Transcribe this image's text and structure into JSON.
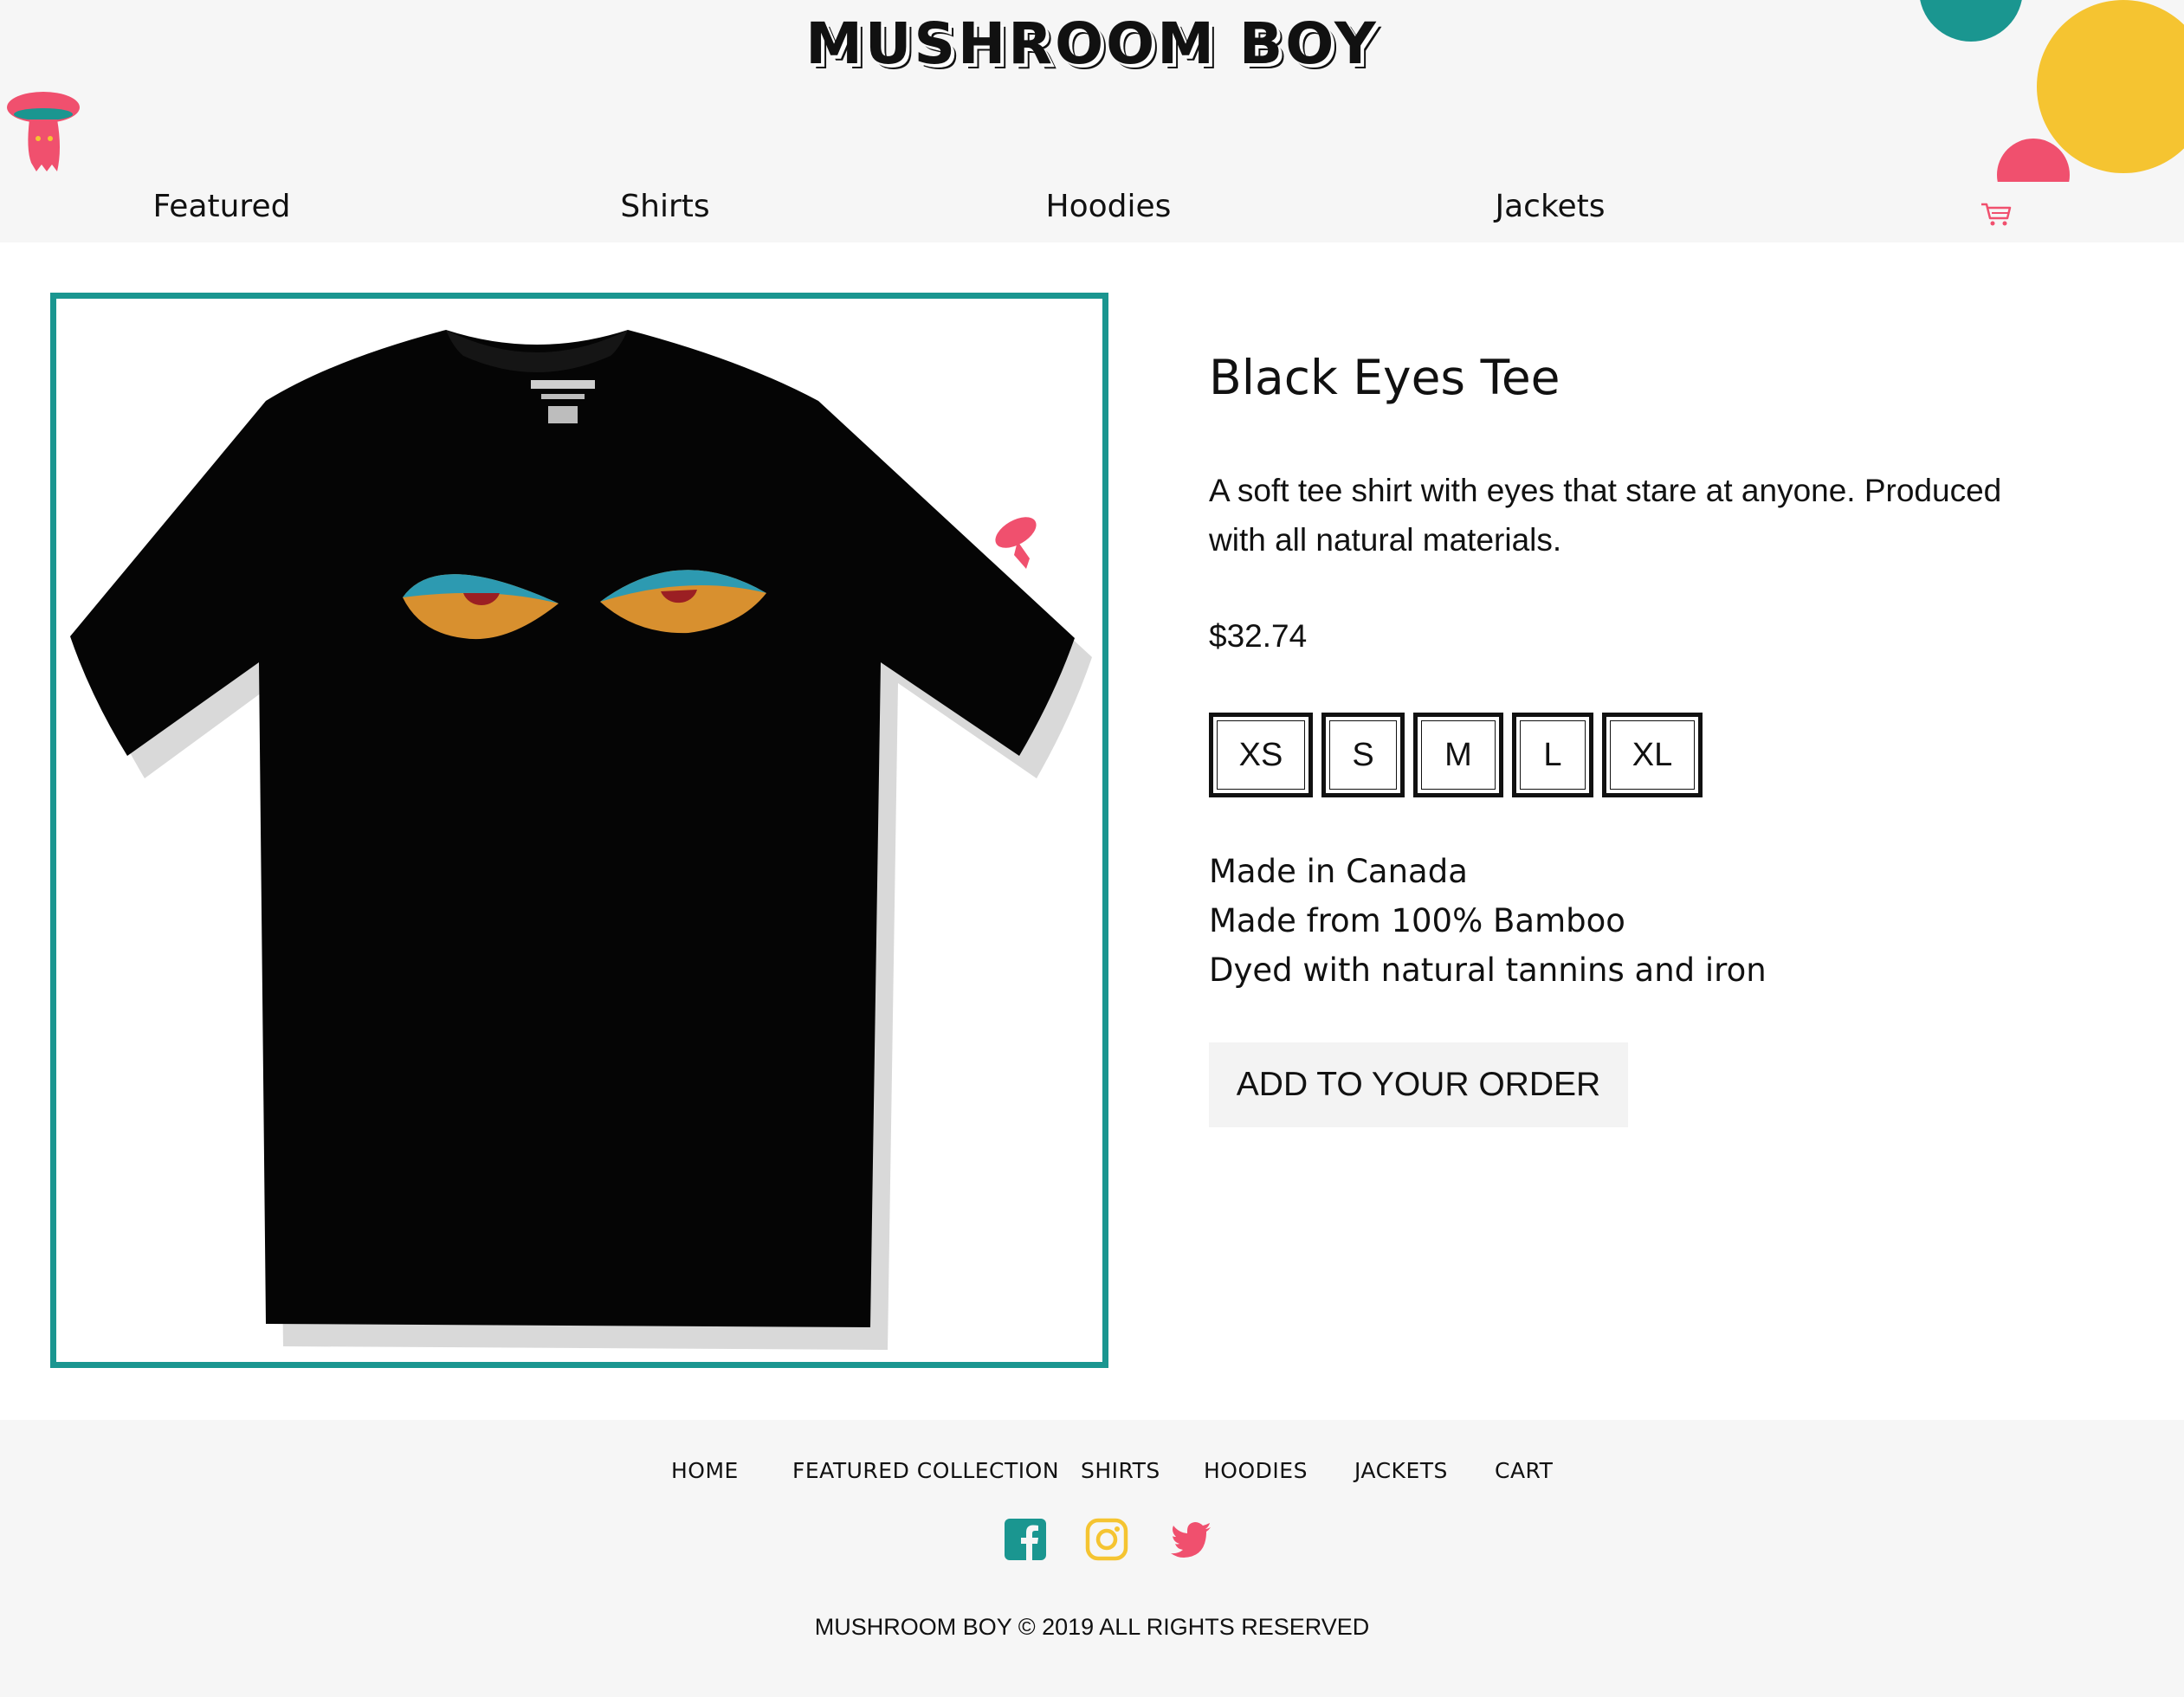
{
  "header": {
    "brand": "MUSHROOM BOY",
    "colors": {
      "teal": "#1a9690",
      "yellow": "#f5c431",
      "pink": "#f0506e"
    }
  },
  "nav": {
    "items": [
      {
        "label": "Featured"
      },
      {
        "label": "Shirts"
      },
      {
        "label": "Hoodies"
      },
      {
        "label": "Jackets"
      }
    ],
    "cart_icon": "cart-icon"
  },
  "product": {
    "image_icon": "t-shirt-image",
    "title": "Black Eyes Tee",
    "description": "A soft tee shirt with eyes that stare at anyone. Produced with all natural materials.",
    "price": "$32.74",
    "sizes": [
      "XS",
      "S",
      "M",
      "L",
      "XL"
    ],
    "features": [
      "Made in Canada",
      "Made from 100% Bamboo",
      "Dyed with natural tannins and iron"
    ],
    "add_button": "ADD TO YOUR ORDER"
  },
  "footer": {
    "links": [
      "HOME",
      "FEATURED COLLECTION",
      "SHIRTS",
      "HOODIES",
      "JACKETS",
      "CART"
    ],
    "social": [
      "facebook-icon",
      "instagram-icon",
      "twitter-icon"
    ],
    "copyright": "MUSHROOM BOY © 2019 ALL RIGHTS RESERVED"
  }
}
